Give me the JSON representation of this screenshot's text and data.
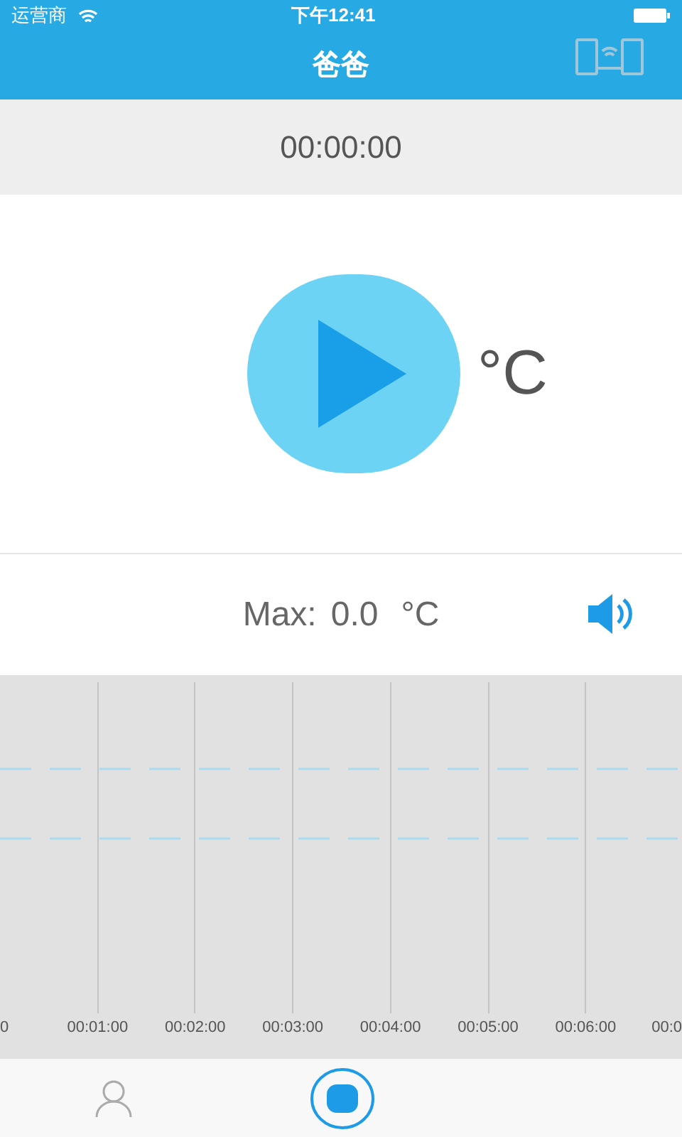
{
  "status_bar": {
    "carrier": "运营商",
    "time": "下午12:41"
  },
  "nav": {
    "title": "爸爸"
  },
  "timer": "00:00:00",
  "reading": {
    "unit": "°C",
    "playing": false
  },
  "max": {
    "label": "Max:",
    "value": "0.0",
    "unit": "°C",
    "sound_on": true
  },
  "chart": {
    "time_labels": [
      "0",
      "00:01:00",
      "00:02:00",
      "00:03:00",
      "00:04:00",
      "00:05:00",
      "00:06:00",
      "00:0"
    ]
  },
  "tab_bar": [
    {
      "kind": "profile",
      "selected": false
    },
    {
      "kind": "record",
      "selected": true
    }
  ]
}
